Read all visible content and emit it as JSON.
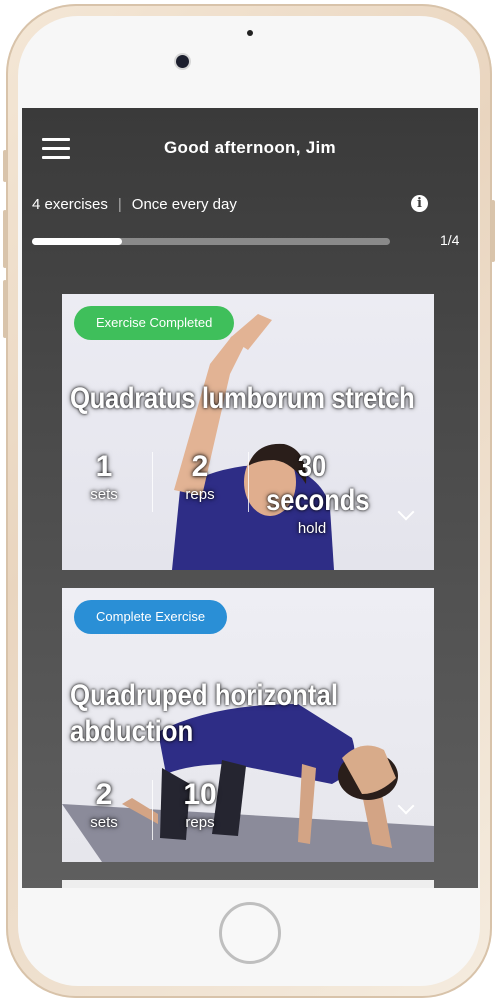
{
  "header": {
    "greeting": "Good afternoon, Jim"
  },
  "summary": {
    "exercises": "4 exercises",
    "frequency": "Once every day"
  },
  "progress": {
    "current": 1,
    "total": 4,
    "fraction": 0.25,
    "label": "1/4"
  },
  "colors": {
    "completed": "#3fbf5b",
    "pending": "#2a8fd6",
    "background": "#3a3a3a"
  },
  "exercises": [
    {
      "status": "Exercise Completed",
      "title": "Quadratus lumborum stretch",
      "stats": [
        {
          "value": "1",
          "label": "sets"
        },
        {
          "value": "2",
          "label": "reps"
        },
        {
          "value": "30 seconds",
          "label": "hold"
        }
      ]
    },
    {
      "status": "Complete Exercise",
      "title": "Quadruped horizontal abduction",
      "stats": [
        {
          "value": "2",
          "label": "sets"
        },
        {
          "value": "10",
          "label": "reps"
        }
      ]
    }
  ]
}
